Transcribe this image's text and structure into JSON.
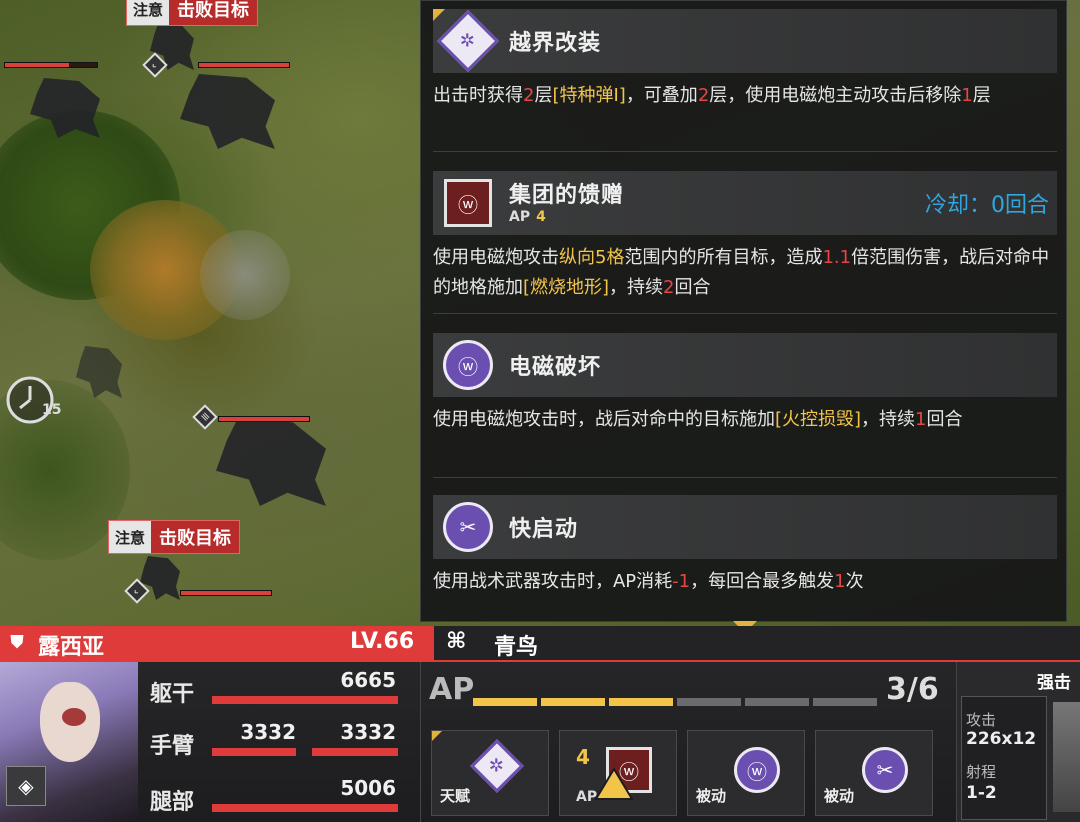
{
  "map": {
    "notice_tags": [
      {
        "label_a": "注意",
        "label_b": "击败目标"
      },
      {
        "label_a": "注意",
        "label_b": "击败目标"
      }
    ],
    "turn_clock": "15"
  },
  "skills": [
    {
      "name": "越界改装",
      "icon": "talent-diamond-icon",
      "desc_parts": [
        {
          "t": "出击时获得",
          "c": ""
        },
        {
          "t": "2",
          "c": "r"
        },
        {
          "t": "层",
          "c": ""
        },
        {
          "t": "[特种弹Ⅰ]",
          "c": "y"
        },
        {
          "t": "，可叠加",
          "c": ""
        },
        {
          "t": "2",
          "c": "r"
        },
        {
          "t": "层，使用电磁炮主动攻击后移除",
          "c": ""
        },
        {
          "t": "1",
          "c": "r"
        },
        {
          "t": "层",
          "c": ""
        }
      ]
    },
    {
      "name": "集团的馈赠",
      "icon": "active-skill-icon",
      "ap_label": "AP",
      "ap": "4",
      "cooldown": "冷却：0回合",
      "desc_parts": [
        {
          "t": "使用电磁炮攻击",
          "c": ""
        },
        {
          "t": "纵向5格",
          "c": "y"
        },
        {
          "t": "范围内的所有目标，造成",
          "c": ""
        },
        {
          "t": "1.1",
          "c": "r"
        },
        {
          "t": "倍范围伤害，战后对命中的地格施加",
          "c": ""
        },
        {
          "t": "[燃烧地形]",
          "c": "y"
        },
        {
          "t": "，持续",
          "c": ""
        },
        {
          "t": "2",
          "c": "r"
        },
        {
          "t": "回合",
          "c": ""
        }
      ]
    },
    {
      "name": "电磁破坏",
      "icon": "passive-emp-icon",
      "desc_parts": [
        {
          "t": "使用电磁炮攻击时，战后对命中的目标施加",
          "c": ""
        },
        {
          "t": "[火控损毁]",
          "c": "y"
        },
        {
          "t": "，持续",
          "c": ""
        },
        {
          "t": "1",
          "c": "r"
        },
        {
          "t": "回合",
          "c": ""
        }
      ]
    },
    {
      "name": "快启动",
      "icon": "passive-quickstart-icon",
      "desc_parts": [
        {
          "t": "使用战术武器攻击时，AP消耗",
          "c": ""
        },
        {
          "t": "-1",
          "c": "r"
        },
        {
          "t": "，每回合最多触发",
          "c": ""
        },
        {
          "t": "1",
          "c": "r"
        },
        {
          "t": "次",
          "c": ""
        }
      ]
    }
  ],
  "hud": {
    "pilot_name": "露西亚",
    "level": "LV.66",
    "mech_name": "青鸟",
    "parts": {
      "torso_label": "躯干",
      "torso_value": "6665",
      "arm_label": "手臂",
      "arm_left_value": "3332",
      "arm_right_value": "3332",
      "leg_label": "腿部",
      "leg_value": "5006"
    },
    "ap": {
      "label": "AP",
      "count": "3/6",
      "current": 3,
      "max": 6
    },
    "cards": [
      {
        "caption": "天赋",
        "icon": "talent-diamond-icon"
      },
      {
        "caption": "",
        "ap_num": "4",
        "ap_label": "AP",
        "icon": "active-skill-icon"
      },
      {
        "caption": "被动",
        "icon": "passive-emp-icon"
      },
      {
        "caption": "被动",
        "icon": "passive-quickstart-icon"
      }
    ],
    "weapon": {
      "title": "强击",
      "attack_label": "攻击",
      "attack_value": "226x12",
      "range_label": "射程",
      "range_value": "1-2"
    }
  },
  "colors": {
    "accent_red": "#e03b3b",
    "accent_yellow": "#f2c44a",
    "accent_blue": "#2fa6e0",
    "purple": "#6a4fb0"
  }
}
